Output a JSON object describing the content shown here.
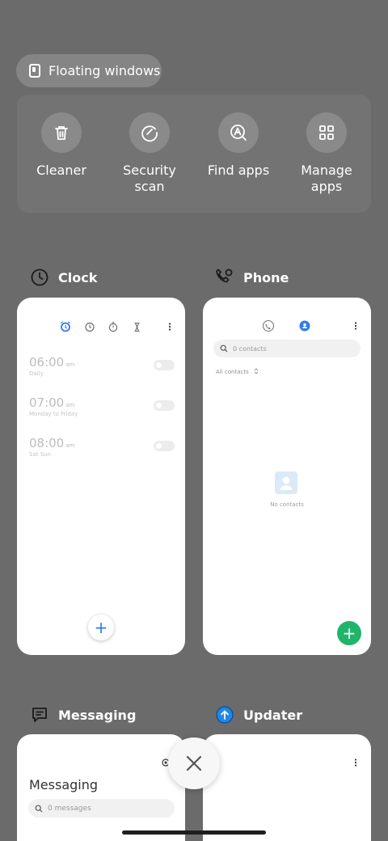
{
  "floating_windows": {
    "label": "Floating windows",
    "icon": "floating-window-icon"
  },
  "tools": [
    {
      "label": "Cleaner",
      "icon": "trash-icon"
    },
    {
      "label": "Security scan",
      "icon": "security-scan-icon"
    },
    {
      "label": "Find apps",
      "icon": "find-apps-icon"
    },
    {
      "label": "Manage apps",
      "icon": "grid-icon"
    }
  ],
  "recent_apps": {
    "clock": {
      "name": "Clock",
      "alarms": [
        {
          "time": "06:00",
          "ampm": "am",
          "repeat": "Daily"
        },
        {
          "time": "07:00",
          "ampm": "am",
          "repeat": "Monday to Friday"
        },
        {
          "time": "08:00",
          "ampm": "am",
          "repeat": "Sat Sun"
        }
      ],
      "add_label": "+"
    },
    "phone": {
      "name": "Phone",
      "search_placeholder": "0 contacts",
      "filter_label": "All contacts",
      "empty_text": "No contacts",
      "add_label": "+"
    },
    "messaging": {
      "name": "Messaging",
      "title": "Messaging",
      "search_placeholder": "0 messages"
    },
    "updater": {
      "name": "Updater"
    }
  },
  "colors": {
    "accent": "#2f7bea",
    "green": "#21b56b",
    "background": "#6b6b6b"
  }
}
